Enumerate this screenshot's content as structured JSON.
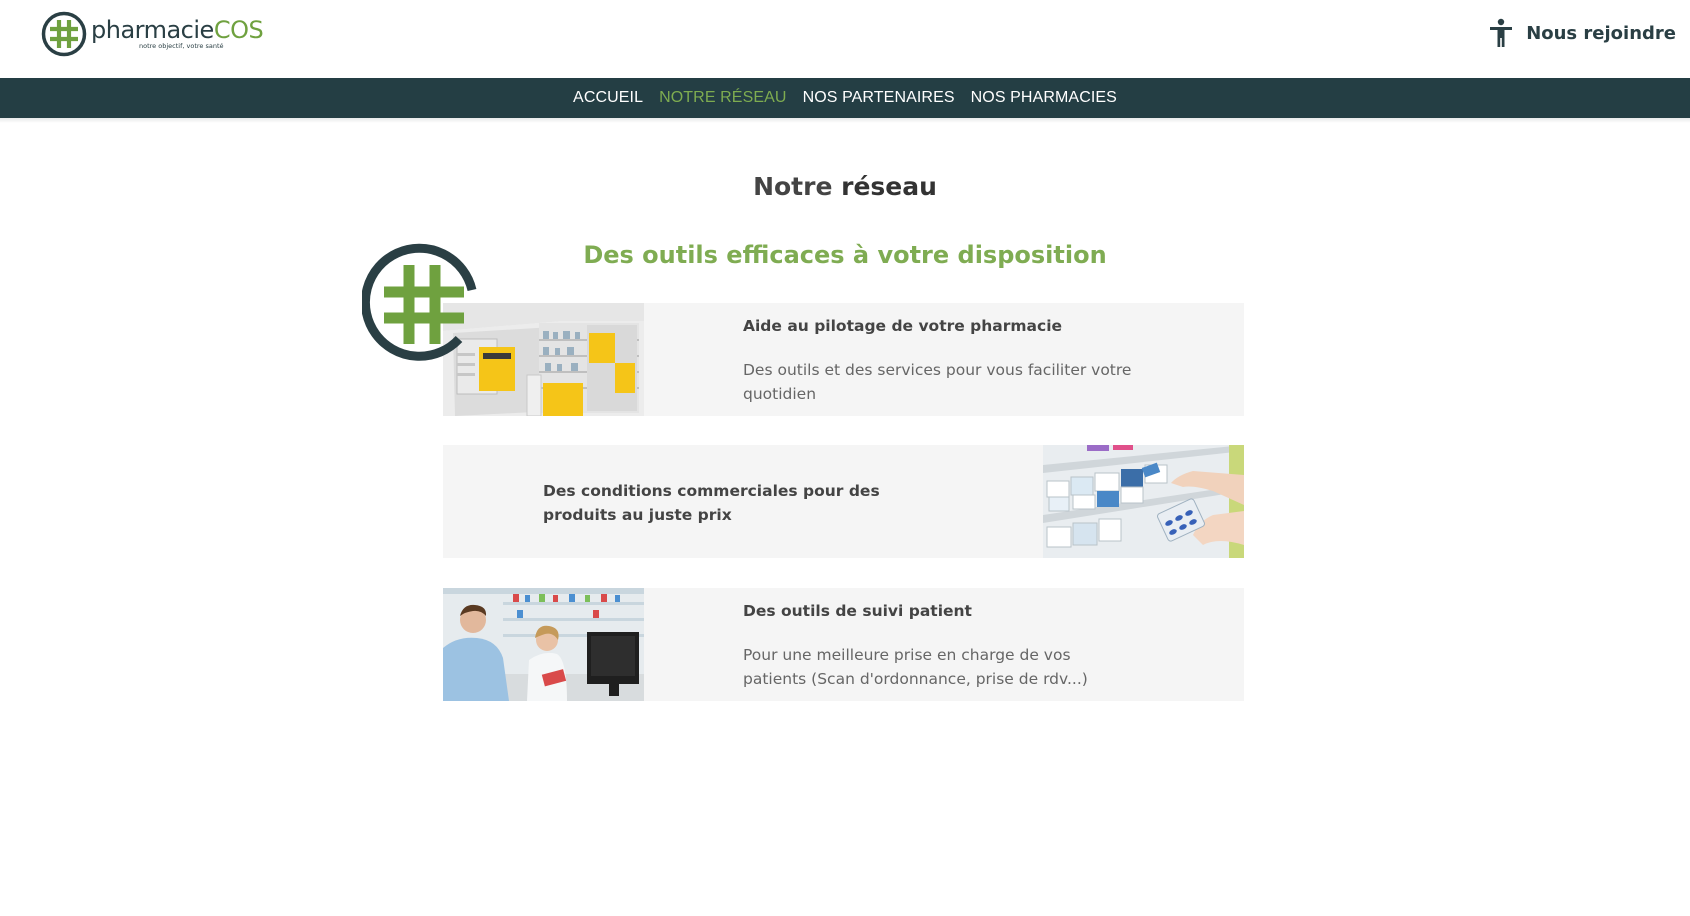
{
  "header": {
    "logo": {
      "brand_part1": "pharmacie",
      "brand_part2": "COS",
      "tagline": "notre objectif, votre santé",
      "icon": "hashtag-logo-icon"
    },
    "join": {
      "icon": "accessibility-person-icon",
      "label": "Nous rejoindre"
    }
  },
  "nav": {
    "items": [
      {
        "label": "ACCUEIL",
        "active": false
      },
      {
        "label": "NOTRE RÉSEAU",
        "active": true
      },
      {
        "label": "NOS PARTENAIRES",
        "active": false
      },
      {
        "label": "NOS PHARMACIES",
        "active": false
      }
    ]
  },
  "main": {
    "title_part1": "Notre ",
    "title_part2": "réseau",
    "subtitle": "Des outils efficaces à votre disposition",
    "cards": [
      {
        "title": "Aide au pilotage de votre pharmacie",
        "description": "Des outils et des services pour vous faciliter votre quotidien",
        "image": "pharmacy-interior-image"
      },
      {
        "title": "Des conditions commerciales pour des produits au juste prix",
        "image": "pharmacy-shelf-medicines-image"
      },
      {
        "title": "Des outils de suivi patient",
        "description": "Pour une meilleure prise en charge de vos patients (Scan d'ordonnance, prise de rdv...)",
        "image": "pharmacist-patient-image"
      }
    ]
  },
  "colors": {
    "brand_dark": "#243e44",
    "brand_green": "#7eac50",
    "card_bg": "#f5f5f5"
  }
}
